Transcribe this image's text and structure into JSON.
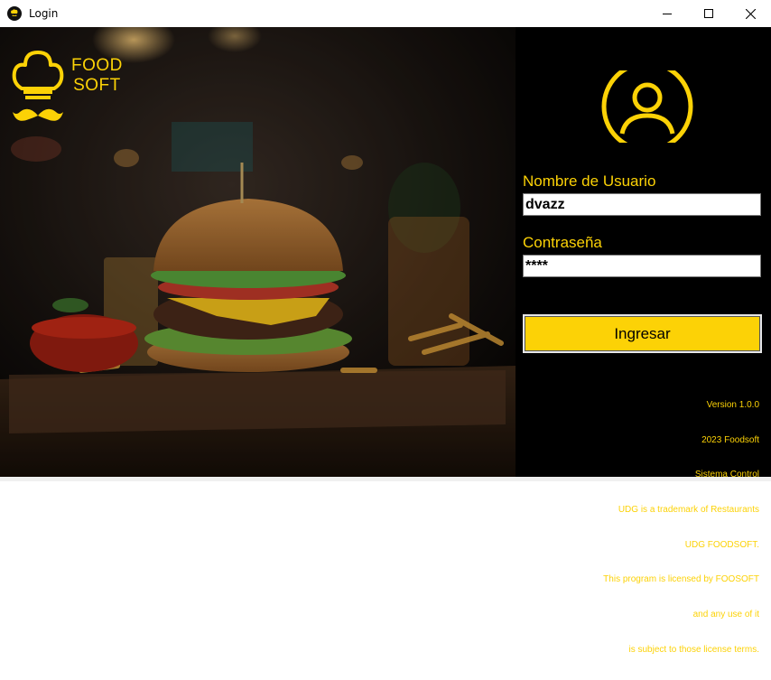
{
  "window": {
    "title": "Login",
    "icon": "chef-hat-icon",
    "controls": [
      "minimize-icon",
      "maximize-icon",
      "close-icon"
    ]
  },
  "brand": {
    "logo_icon": "chef-hat-mustache-icon",
    "line1": "FOOD",
    "line2": "SOFT",
    "accent_color": "#fcd206"
  },
  "login": {
    "avatar_icon": "user-circle-icon",
    "username_label": "Nombre de Usuario",
    "username_value": "dvazz",
    "password_label": "Contraseña",
    "password_value": "****",
    "submit_label": "Ingresar"
  },
  "footer": {
    "lines": [
      "Version 1.0.0",
      "2023 Foodsoft",
      "Sistema Control",
      "UDG is a trademark of Restaurants",
      "UDG FOODSOFT.",
      "This program is licensed by FOOSOFT",
      "and any use of it",
      "is subject to those license terms."
    ]
  }
}
